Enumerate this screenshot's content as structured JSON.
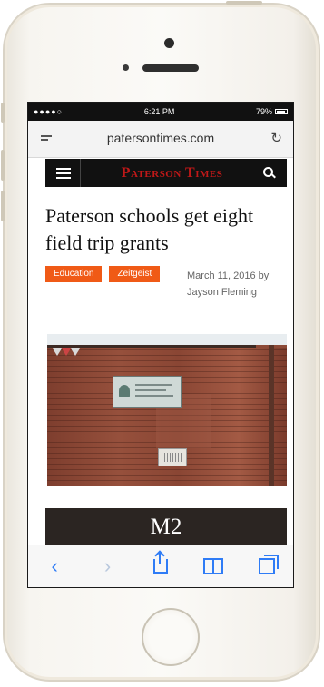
{
  "status_bar": {
    "carrier": "●●●●○",
    "time": "6:21 PM",
    "battery": "79%"
  },
  "browser": {
    "url": "patersontimes.com"
  },
  "site": {
    "masthead": "Paterson Times"
  },
  "article": {
    "headline": "Paterson schools get eight field trip grants",
    "tags": [
      "Education",
      "Zeitgeist"
    ],
    "byline_date": "March 11, 2016 by",
    "byline_author": "Jayson Fleming"
  },
  "ad": {
    "text": "M2"
  },
  "colors": {
    "tag": "#f05a16",
    "masthead": "#c01818",
    "toolbar_accent": "#2f7cf6"
  },
  "toolbar": {
    "back_icon": "chevron-left-icon",
    "forward_icon": "chevron-right-icon",
    "share_icon": "share-icon",
    "bookmarks_icon": "book-icon",
    "tabs_icon": "tabs-icon"
  }
}
